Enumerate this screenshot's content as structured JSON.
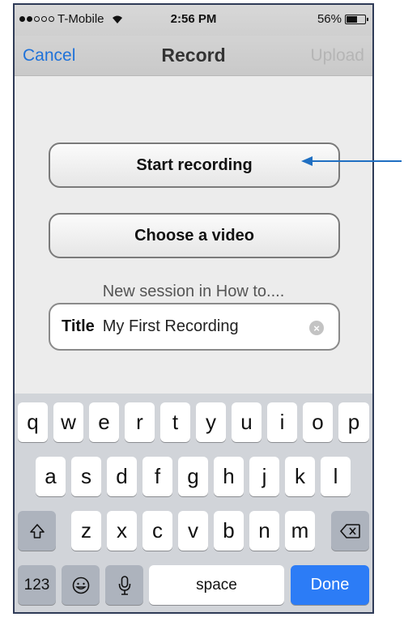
{
  "status_bar": {
    "carrier": "T-Mobile",
    "time": "2:56 PM",
    "battery": "56%",
    "battery_level": 0.56,
    "signal_icon": "signal-dots-icon",
    "wifi_icon": "wifi-icon"
  },
  "nav": {
    "cancel": "Cancel",
    "title": "Record",
    "upload": "Upload"
  },
  "main": {
    "start_recording": "Start recording",
    "choose_video": "Choose a video",
    "session_label": "New session in How to....",
    "title_field": {
      "label": "Title",
      "value": "My First Recording"
    }
  },
  "keyboard": {
    "row1": [
      "q",
      "w",
      "e",
      "r",
      "t",
      "y",
      "u",
      "i",
      "o",
      "p"
    ],
    "row2": [
      "a",
      "s",
      "d",
      "f",
      "g",
      "h",
      "j",
      "k",
      "l"
    ],
    "row3": [
      "z",
      "x",
      "c",
      "v",
      "b",
      "n",
      "m"
    ],
    "numbers": "123",
    "space": "space",
    "done": "Done"
  },
  "colors": {
    "accent": "#1f72d9",
    "done_key": "#2c7cf6",
    "annotation_arrow": "#1f6fc2"
  }
}
